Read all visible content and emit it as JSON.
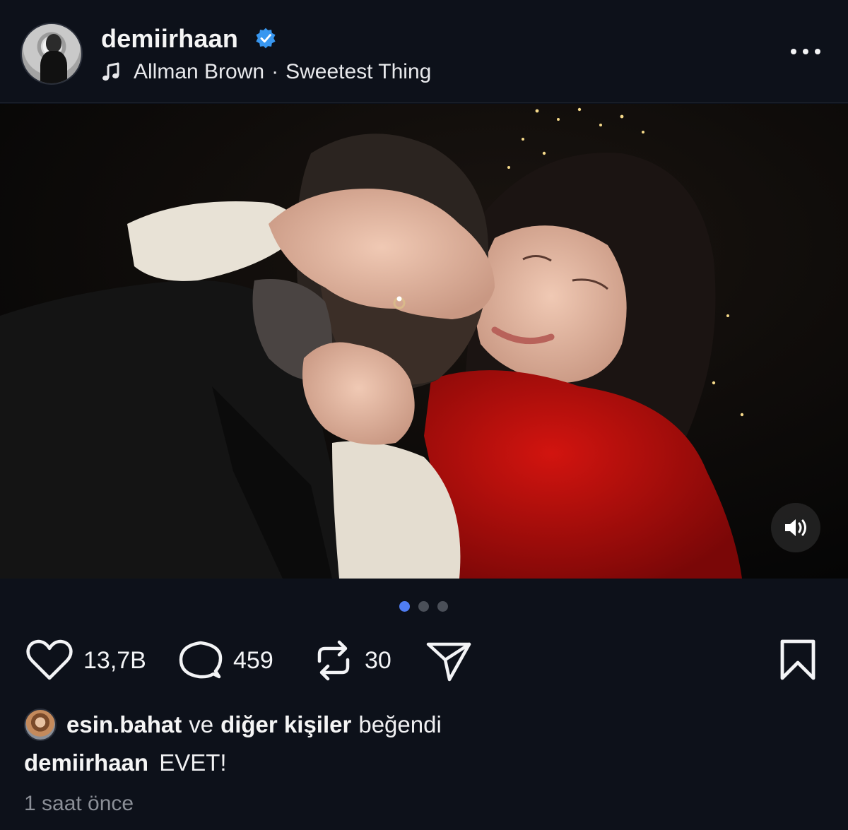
{
  "header": {
    "username": "demiirhaan",
    "verified": true,
    "music": {
      "artist": "Allman Brown",
      "separator": "·",
      "track": "Sweetest Thing"
    }
  },
  "media": {
    "carousel_total": 3,
    "carousel_current": 1
  },
  "actions": {
    "likes": "13,7B",
    "comments": "459",
    "reposts": "30"
  },
  "liked_by": {
    "user": "esin.bahat",
    "connector": "ve",
    "others": "diğer kişiler",
    "suffix": "beğendi"
  },
  "caption": {
    "username": "demiirhaan",
    "text": "EVET!"
  },
  "timestamp": "1 saat önce",
  "colors": {
    "background": "#0d111a",
    "verified_badge": "#3897f0",
    "active_dot": "#4f7df2",
    "inactive_dot": "#4a4f58",
    "muted_text": "#8b8f97"
  },
  "icons": [
    "music-note-icon",
    "verified-badge-icon",
    "more-options-icon",
    "sound-icon",
    "heart-icon",
    "comment-icon",
    "repost-icon",
    "share-icon",
    "bookmark-icon"
  ]
}
